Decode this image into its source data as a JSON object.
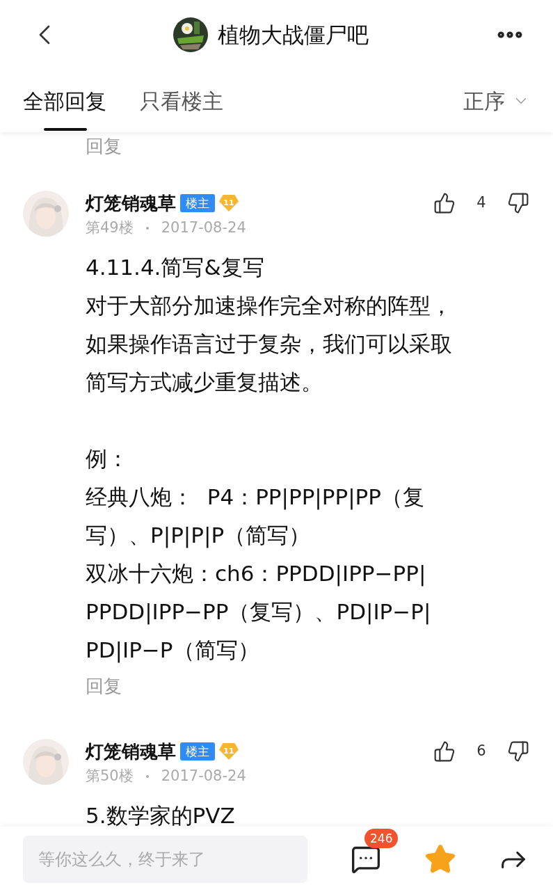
{
  "header": {
    "title": "植物大战僵尸吧"
  },
  "tabs": [
    {
      "label": "全部回复",
      "selected": true
    },
    {
      "label": "只看楼主",
      "selected": false
    }
  ],
  "sort": {
    "label": "正序"
  },
  "clipped_reply": "回复",
  "posts": [
    {
      "author": "灯笼销魂草",
      "badge": "楼主",
      "level": "11",
      "floor": "第49楼",
      "date": "2017-08-24",
      "likes": "4",
      "paragraphs": [
        [
          "4.11.4.简写&复写",
          "对于大部分加速操作完全对称的阵型，",
          "如果操作语言过于复杂，我们可以采取",
          "简写方式减少重复描述。"
        ],
        [
          "例：",
          "经典八炮：  P4：PP|PP|PP|PP（复",
          "写）、P|P|P|P（简写）",
          "双冰十六炮：ch6：PPDD|IPP−PP|",
          "PPDD|IPP−PP（复写）、PD|IP−P|",
          "PD|IP−P（简写）"
        ]
      ],
      "reply": "回复"
    },
    {
      "author": "灯笼销魂草",
      "badge": "楼主",
      "level": "11",
      "floor": "第50楼",
      "date": "2017-08-24",
      "likes": "6",
      "paragraphs": [
        [
          "5.数学家的PVZ"
        ]
      ]
    }
  ],
  "bottom_bar": {
    "placeholder": "等你这么久，终于来了",
    "comment_count": "246",
    "favorited": true
  }
}
